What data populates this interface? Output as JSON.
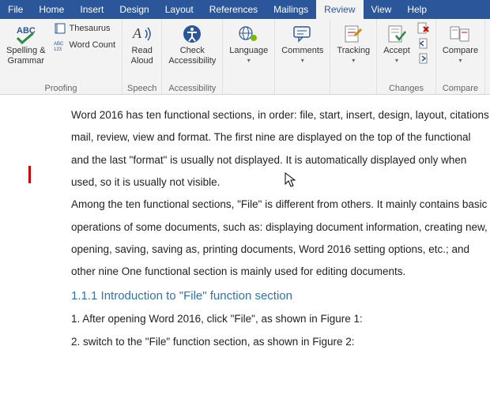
{
  "tabs": {
    "file": "File",
    "home": "Home",
    "insert": "Insert",
    "design": "Design",
    "layout": "Layout",
    "references": "References",
    "mailings": "Mailings",
    "review": "Review",
    "view": "View",
    "help": "Help",
    "active": "review"
  },
  "ribbon": {
    "proofing": {
      "group": "Proofing",
      "spelling": "Spelling &\nGrammar",
      "thesaurus": "Thesaurus",
      "wordcount": "Word Count"
    },
    "speech": {
      "group": "Speech",
      "read_aloud": "Read\nAloud"
    },
    "accessibility": {
      "group": "Accessibility",
      "check": "Check\nAccessibility"
    },
    "language": {
      "group": "",
      "language": "Language"
    },
    "comments": {
      "group": "",
      "comments": "Comments"
    },
    "tracking": {
      "group": "",
      "tracking": "Tracking"
    },
    "changes": {
      "group": "Changes",
      "accept": "Accept"
    },
    "compare": {
      "group": "Compare",
      "compare": "Compare"
    }
  },
  "document": {
    "p1": "Word 2016 has ten functional sections, in order: file, start, insert, design, layout, citations,",
    "p2": "mail, review, view and format. The first nine are displayed on the top of the functional",
    "p3": "and the last \"format\" is usually not displayed. It is automatically displayed only when",
    "p4": "used, so it is usually not visible.",
    "p5": "Among the ten functional sections, \"File\" is different from others. It mainly contains basic",
    "p6": "operations of some documents, such as: displaying document information, creating new,",
    "p7": "opening, saving, saving as, printing documents, Word 2016 setting options, etc.; and",
    "p8": "other nine One functional section is mainly used for editing documents.",
    "h1": "1.1.1 Introduction to \"File\" function section",
    "p9": "1. After opening Word 2016, click \"File\", as shown in Figure 1:",
    "p10": "2. switch to the \"File\" function section, as shown in Figure 2:"
  }
}
